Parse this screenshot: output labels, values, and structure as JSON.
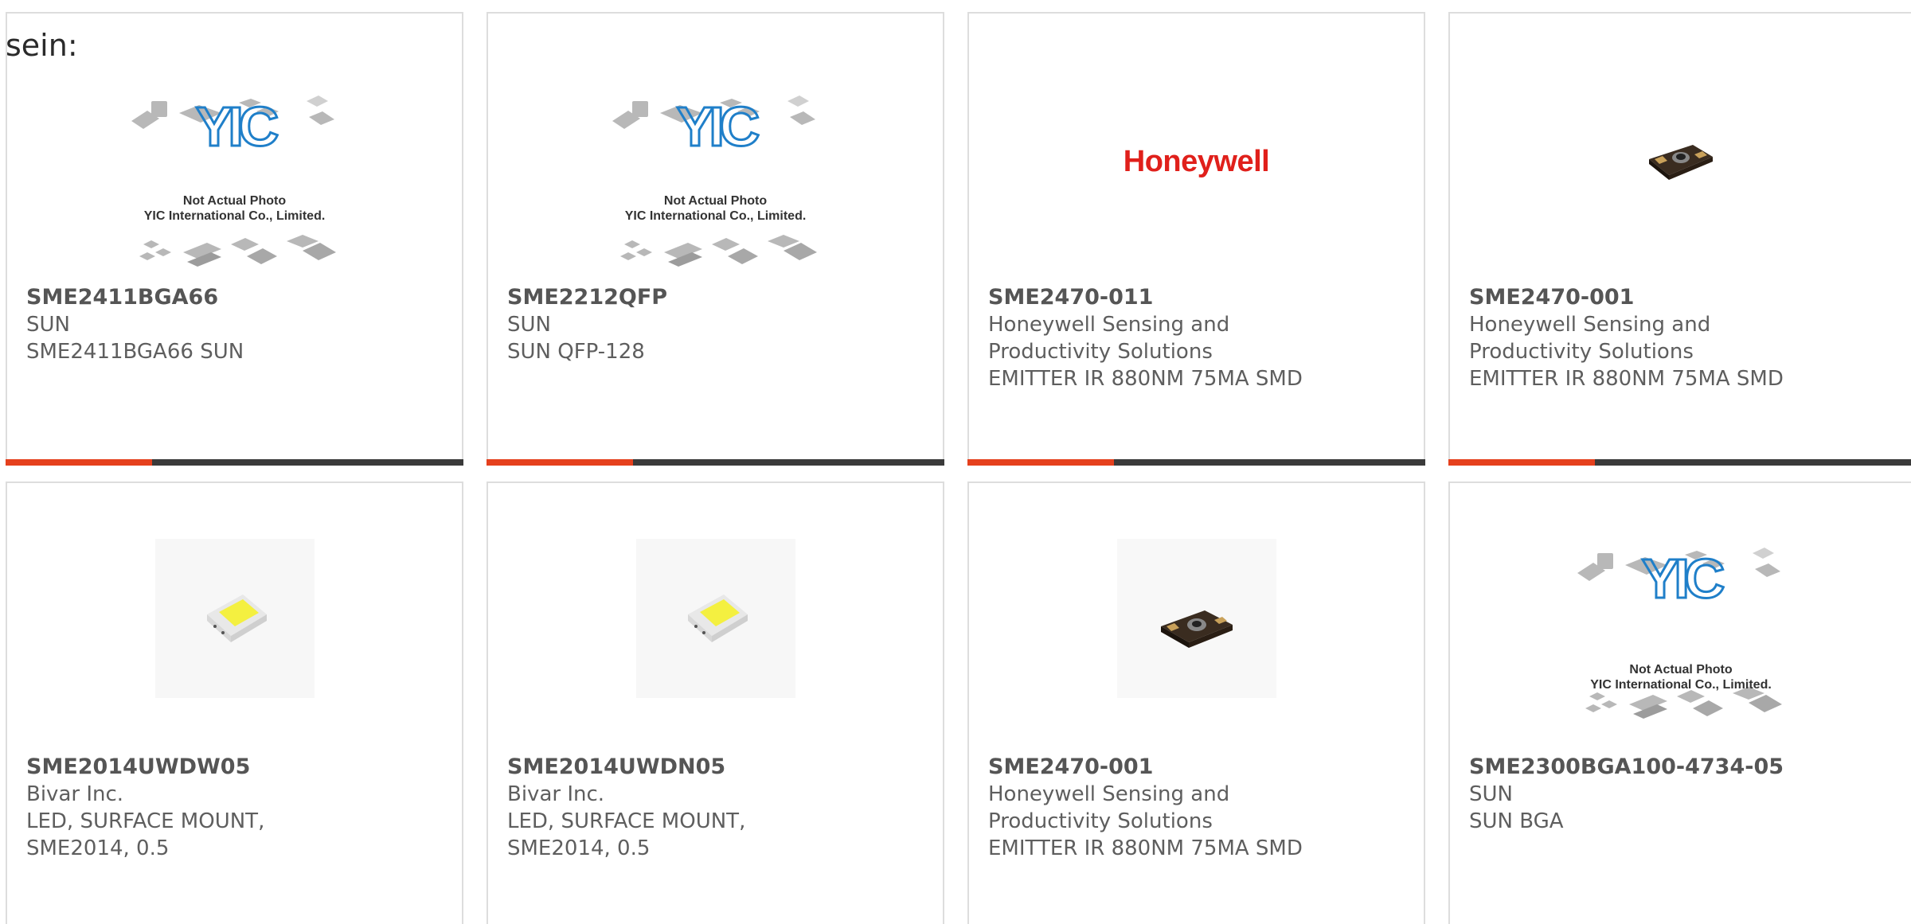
{
  "intro_text": "sein:",
  "placeholder_caption": {
    "line1": "Not Actual Photo",
    "line2": "YIC International Co., Limited."
  },
  "brand_logo_text": "Honeywell",
  "accent_color": "#e5401d",
  "products": [
    {
      "part": "SME2411BGA66",
      "lines": [
        "SUN",
        "SME2411BGA66 SUN"
      ],
      "image": "yic-placeholder"
    },
    {
      "part": "SME2212QFP",
      "lines": [
        "SUN",
        "SUN QFP-128"
      ],
      "image": "yic-placeholder"
    },
    {
      "part": "SME2470-011",
      "lines": [
        "Honeywell Sensing and",
        "Productivity Solutions",
        "EMITTER IR 880NM 75MA SMD"
      ],
      "image": "honeywell-logo"
    },
    {
      "part": "SME2470-001",
      "lines": [
        "Honeywell Sensing and",
        "Productivity Solutions",
        "EMITTER IR 880NM 75MA SMD"
      ],
      "image": "ir-emitter"
    },
    {
      "part": "SME2014UWDW05",
      "lines": [
        "Bivar Inc.",
        "LED, SURFACE MOUNT,",
        "SME2014, 0.5"
      ],
      "image": "smd-led"
    },
    {
      "part": "SME2014UWDN05",
      "lines": [
        "Bivar Inc.",
        "LED, SURFACE MOUNT,",
        "SME2014, 0.5"
      ],
      "image": "smd-led"
    },
    {
      "part": "SME2470-001",
      "lines": [
        "Honeywell Sensing and",
        "Productivity Solutions",
        "EMITTER IR 880NM 75MA SMD"
      ],
      "image": "ir-emitter"
    },
    {
      "part": "SME2300BGA100-4734-05",
      "lines": [
        "SUN",
        "SUN BGA"
      ],
      "image": "yic-placeholder"
    }
  ]
}
